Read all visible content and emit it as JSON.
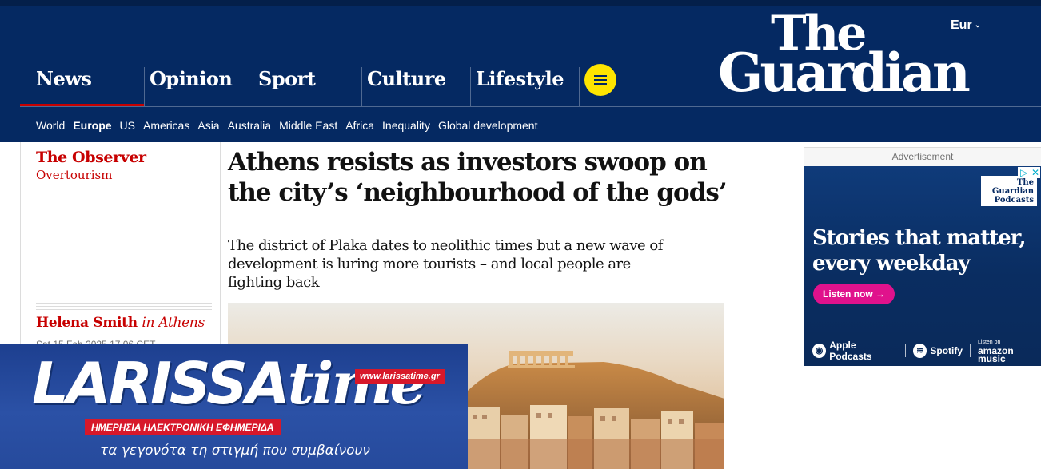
{
  "edition": {
    "label": "Eur"
  },
  "logo": {
    "line1": "The",
    "line2": "Guardian"
  },
  "pillars": [
    {
      "label": "News",
      "active": true
    },
    {
      "label": "Opinion"
    },
    {
      "label": "Sport"
    },
    {
      "label": "Culture"
    },
    {
      "label": "Lifestyle"
    }
  ],
  "subnav": [
    "World",
    "Europe",
    "US",
    "Americas",
    "Asia",
    "Australia",
    "Middle East",
    "Africa",
    "Inequality",
    "Global development"
  ],
  "article": {
    "series": "The Observer",
    "series_sub": "Overtourism",
    "headline": "Athens resists as investors swoop on the city’s ‘neighbourhood of the gods’",
    "standfirst": "The district of Plaka dates to neolithic times but a new wave of development is luring more tourists – and local people are fighting back",
    "byline_name": "Helena Smith",
    "byline_loc": "in Athens",
    "dateline": "Sat 15 Feb 2025 17.06 CET"
  },
  "ad": {
    "label": "Advertisement",
    "logo_line1": "The",
    "logo_line2": "Guardian",
    "logo_line3": "Podcasts",
    "headline": "Stories that matter, every weekday",
    "cta": "Listen now →",
    "apple": "Apple Podcasts",
    "spotify": "Spotify",
    "amazon_small": "Listen on",
    "amazon": "amazon music"
  },
  "overlay": {
    "brand_a": "LARISSA",
    "brand_b": "time",
    "url": "www.larissatime.gr",
    "strip": "ΗΜΕΡΗΣΙΑ ΗΛΕΚΤΡΟΝΙΚΗ ΕΦΗΜΕΡΙΔΑ",
    "tagline": "τα γεγονότα τη στιγμή που συμβαίνουν"
  },
  "colors": {
    "brand": "#052962",
    "accent": "#c70000",
    "menu": "#ffe500"
  },
  "icons": [
    "menu-icon",
    "chevron-down-icon",
    "play-icon",
    "close-icon"
  ]
}
